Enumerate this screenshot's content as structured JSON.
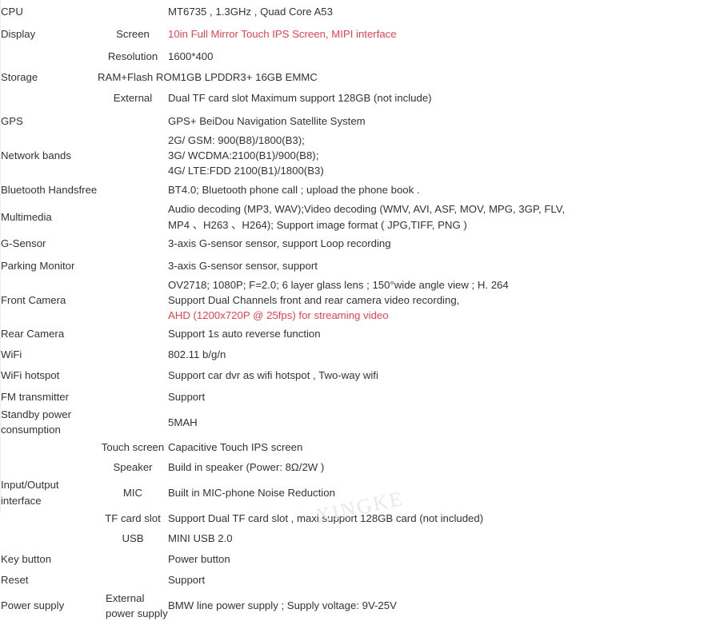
{
  "document": {
    "type": "product-specification-table",
    "watermark_text": "XINGKE",
    "text_color": "#333333",
    "highlight_color": "#e8434f",
    "background_color": "#ffffff"
  },
  "rows": [
    {
      "label": "CPU",
      "sub": "",
      "lines": [
        {
          "text": "MT6735 , 1.3GHz , Quad Core A53",
          "color": "default"
        }
      ]
    },
    {
      "label": "Display",
      "sub": "Screen",
      "lines": [
        {
          "text": "10in Full Mirror Touch IPS Screen, MIPI interface",
          "color": "red"
        }
      ]
    },
    {
      "label": "",
      "sub": "Resolution",
      "lines": [
        {
          "text": "1600*400",
          "color": "default"
        }
      ]
    },
    {
      "label": "Storage",
      "sub": "",
      "span_value": true,
      "lines": [
        {
          "text": "RAM+Flash ROM1GB LPDDR3+ 16GB EMMC",
          "color": "default"
        }
      ]
    },
    {
      "label": "",
      "sub": "External",
      "lines": [
        {
          "text": "Dual TF card slot Maximum support 128GB (not include)",
          "color": "default"
        }
      ]
    },
    {
      "label": "GPS",
      "sub": "",
      "lines": [
        {
          "text": "GPS+ BeiDou Navigation Satellite System",
          "color": "default"
        }
      ]
    },
    {
      "label": "Network bands",
      "sub": "",
      "lines": [
        {
          "text": "2G/ GSM: 900(B8)/1800(B3);",
          "color": "default"
        },
        {
          "text": "3G/ WCDMA:2100(B1)/900(B8);",
          "color": "default"
        },
        {
          "text": "4G/ LTE:FDD 2100(B1)/1800(B3)",
          "color": "default"
        }
      ]
    },
    {
      "label": "Bluetooth Handsfree",
      "sub": "",
      "lines": [
        {
          "text": "BT4.0; Bluetooth phone call ; upload the phone book .",
          "color": "default"
        }
      ]
    },
    {
      "label": "Multimedia",
      "sub": "",
      "lines": [
        {
          "text": "Audio decoding (MP3, WAV);Video decoding (WMV, AVI, ASF, MOV, MPG, 3GP, FLV,",
          "color": "default"
        },
        {
          "text": "MP4 、H263 、H264); Support image format ( JPG,TIFF, PNG )",
          "color": "default"
        }
      ]
    },
    {
      "label": "G-Sensor",
      "sub": "",
      "lines": [
        {
          "text": "3-axis G-sensor sensor, support Loop recording",
          "color": "default"
        }
      ]
    },
    {
      "label": "Parking Monitor",
      "sub": "",
      "lines": [
        {
          "text": "3-axis G-sensor sensor, support",
          "color": "default"
        }
      ]
    },
    {
      "label": "Front Camera",
      "sub": "",
      "lines": [
        {
          "text": "OV2718; 1080P; F=2.0; 6 layer glass lens ; 150°wide angle view ; H. 264",
          "color": "default"
        },
        {
          "text": "Support Dual Channels front and rear camera video recording,",
          "color": "default"
        },
        {
          "text": "AHD (1200x720P @ 25fps) for streaming video",
          "color": "red"
        }
      ]
    },
    {
      "label": "Rear Camera",
      "sub": "",
      "lines": [
        {
          "text": "",
          "color": "default"
        },
        {
          "text": "Support 1s auto reverse function",
          "color": "default"
        }
      ]
    },
    {
      "label": "WiFi",
      "sub": "",
      "lines": [
        {
          "text": "802.11 b/g/n",
          "color": "default"
        }
      ]
    },
    {
      "label": "WiFi hotspot",
      "sub": "",
      "lines": [
        {
          "text": "Support car dvr as wifi hotspot , Two-way wifi",
          "color": "default"
        }
      ]
    },
    {
      "label": "FM transmitter",
      "sub": "",
      "lines": [
        {
          "text": "Support",
          "color": "default"
        }
      ]
    },
    {
      "label": "Standby power consumption",
      "sub": "",
      "lines": [
        {
          "text": "5MAH",
          "color": "default"
        }
      ]
    },
    {
      "label": "",
      "sub": "Touch screen",
      "lines": [
        {
          "text": "Capacitive Touch IPS screen",
          "color": "default"
        }
      ]
    },
    {
      "label": "",
      "sub": "Speaker",
      "lines": [
        {
          "text": "Build in speaker (Power: 8Ω/2W )",
          "color": "default"
        }
      ]
    },
    {
      "label": "Input/Output interface",
      "sub": "MIC",
      "lines": [
        {
          "text": "Built in MIC-phone Noise Reduction",
          "color": "default"
        }
      ]
    },
    {
      "label": "",
      "sub": "TF card slot",
      "lines": [
        {
          "text": "Support Dual TF card slot , maxi support 128GB card  (not included)",
          "color": "default"
        }
      ]
    },
    {
      "label": "",
      "sub": "USB",
      "lines": [
        {
          "text": "MINI USB 2.0",
          "color": "default"
        }
      ]
    },
    {
      "label": "Key button",
      "sub": "",
      "lines": [
        {
          "text": "Power button",
          "color": "default"
        }
      ]
    },
    {
      "label": "Reset",
      "sub": "",
      "lines": [
        {
          "text": "Support",
          "color": "default"
        }
      ]
    },
    {
      "label": "Power supply",
      "sub": "External power supply",
      "sub_align": "left",
      "lines": [
        {
          "text": "BMW line power supply ; Supply voltage: 9V-25V",
          "color": "default"
        }
      ]
    }
  ]
}
